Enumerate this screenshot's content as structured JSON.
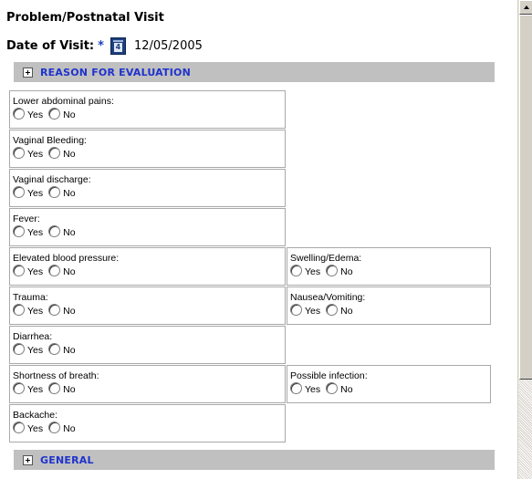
{
  "title": "Problem/Postnatal Visit",
  "date_of_visit": {
    "label": "Date of Visit:",
    "required_mark": "*",
    "calendar_icon_text": "4",
    "value": "12/05/2005"
  },
  "sections": [
    {
      "label": "REASON FOR EVALUATION"
    },
    {
      "label": "GENERAL"
    }
  ],
  "option_labels": {
    "yes": "Yes",
    "no": "No"
  },
  "questions": [
    {
      "text": "Lower abdominal pains:"
    },
    {
      "text": "Vaginal Bleeding:"
    },
    {
      "text": "Vaginal discharge:"
    },
    {
      "text": "Fever:"
    },
    {
      "text": "Elevated blood pressure:"
    },
    {
      "text": "Swelling/Edema:"
    },
    {
      "text": "Trauma:"
    },
    {
      "text": "Nausea/Vomiting:"
    },
    {
      "text": "Diarrhea:"
    },
    {
      "text": "Shortness of breath:"
    },
    {
      "text": "Possible infection:"
    },
    {
      "text": "Backache:"
    }
  ]
}
